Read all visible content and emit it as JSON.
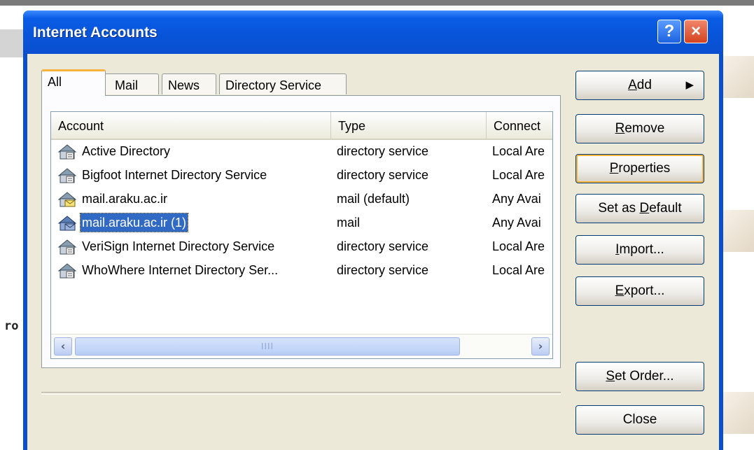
{
  "window": {
    "title": "Internet Accounts",
    "help_label": "?",
    "close_label": "×"
  },
  "background": {
    "partial_text": "ro"
  },
  "tabs": [
    {
      "label": "All",
      "active": true
    },
    {
      "label": "Mail",
      "active": false
    },
    {
      "label": "News",
      "active": false
    },
    {
      "label": "Directory Service",
      "active": false
    }
  ],
  "list": {
    "columns": [
      "Account",
      "Type",
      "Connect"
    ],
    "rows": [
      {
        "account": "Active Directory",
        "type": "directory service",
        "connection": "Local Are",
        "icon": "directory-service-icon",
        "selected": false
      },
      {
        "account": "Bigfoot Internet Directory Service",
        "type": "directory service",
        "connection": "Local Are",
        "icon": "directory-service-icon",
        "selected": false
      },
      {
        "account": "mail.araku.ac.ir",
        "type": "mail (default)",
        "connection": "Any Avai",
        "icon": "mail-account-icon",
        "selected": false
      },
      {
        "account": "mail.araku.ac.ir (1)",
        "type": "mail",
        "connection": "Any Avai",
        "icon": "mail-account-icon",
        "selected": true
      },
      {
        "account": "VeriSign Internet Directory Service",
        "type": "directory service",
        "connection": "Local Are",
        "icon": "directory-service-icon",
        "selected": false
      },
      {
        "account": "WhoWhere Internet Directory Ser...",
        "type": "directory service",
        "connection": "Local Are",
        "icon": "directory-service-icon",
        "selected": false
      }
    ],
    "scroll": {
      "left_icon": "‹",
      "right_icon": "›",
      "grip": "IIII"
    }
  },
  "buttons": {
    "add": {
      "prefix": "",
      "key": "A",
      "suffix": "dd",
      "arrow": "▶"
    },
    "remove": {
      "prefix": "",
      "key": "R",
      "suffix": "emove"
    },
    "properties": {
      "prefix": "",
      "key": "P",
      "suffix": "roperties"
    },
    "set_default": {
      "prefix": "Set as ",
      "key": "D",
      "suffix": "efault"
    },
    "import": {
      "prefix": "",
      "key": "I",
      "suffix": "mport..."
    },
    "export": {
      "prefix": "",
      "key": "E",
      "suffix": "xport..."
    },
    "set_order": {
      "prefix": "",
      "key": "S",
      "suffix": "et Order..."
    },
    "close": {
      "prefix": "",
      "key": "",
      "suffix": "Close"
    }
  },
  "colors": {
    "title_bar": "#0a4fd0",
    "selection": "#316ac5",
    "dialog_face": "#ece9d8",
    "tab_highlight": "#f9b140"
  }
}
